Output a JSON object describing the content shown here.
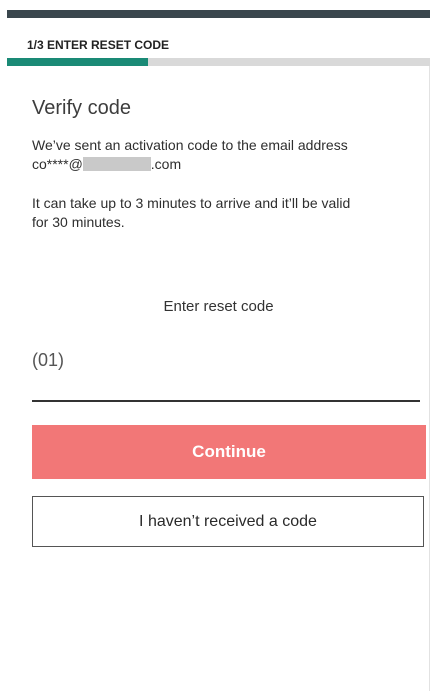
{
  "header": {
    "step_title": "1/3 ENTER RESET CODE",
    "progress_fraction": 0.333
  },
  "content": {
    "title": "Verify code",
    "sent_text": "We’ve sent an activation code to the email address",
    "email_prefix": "co****@",
    "email_suffix": ".com",
    "info_line1": "It can take up to 3 minutes to arrive and it’ll be valid",
    "info_line2": "for 30 minutes.",
    "reset_label": "Enter reset code"
  },
  "code_input": {
    "value": "",
    "placeholder": "(01)"
  },
  "buttons": {
    "continue_label": "Continue",
    "no_code_label": "I haven’t received a code"
  },
  "colors": {
    "progress": "#1a8a76",
    "primary": "#f27777",
    "header_bar": "#3a464d"
  }
}
